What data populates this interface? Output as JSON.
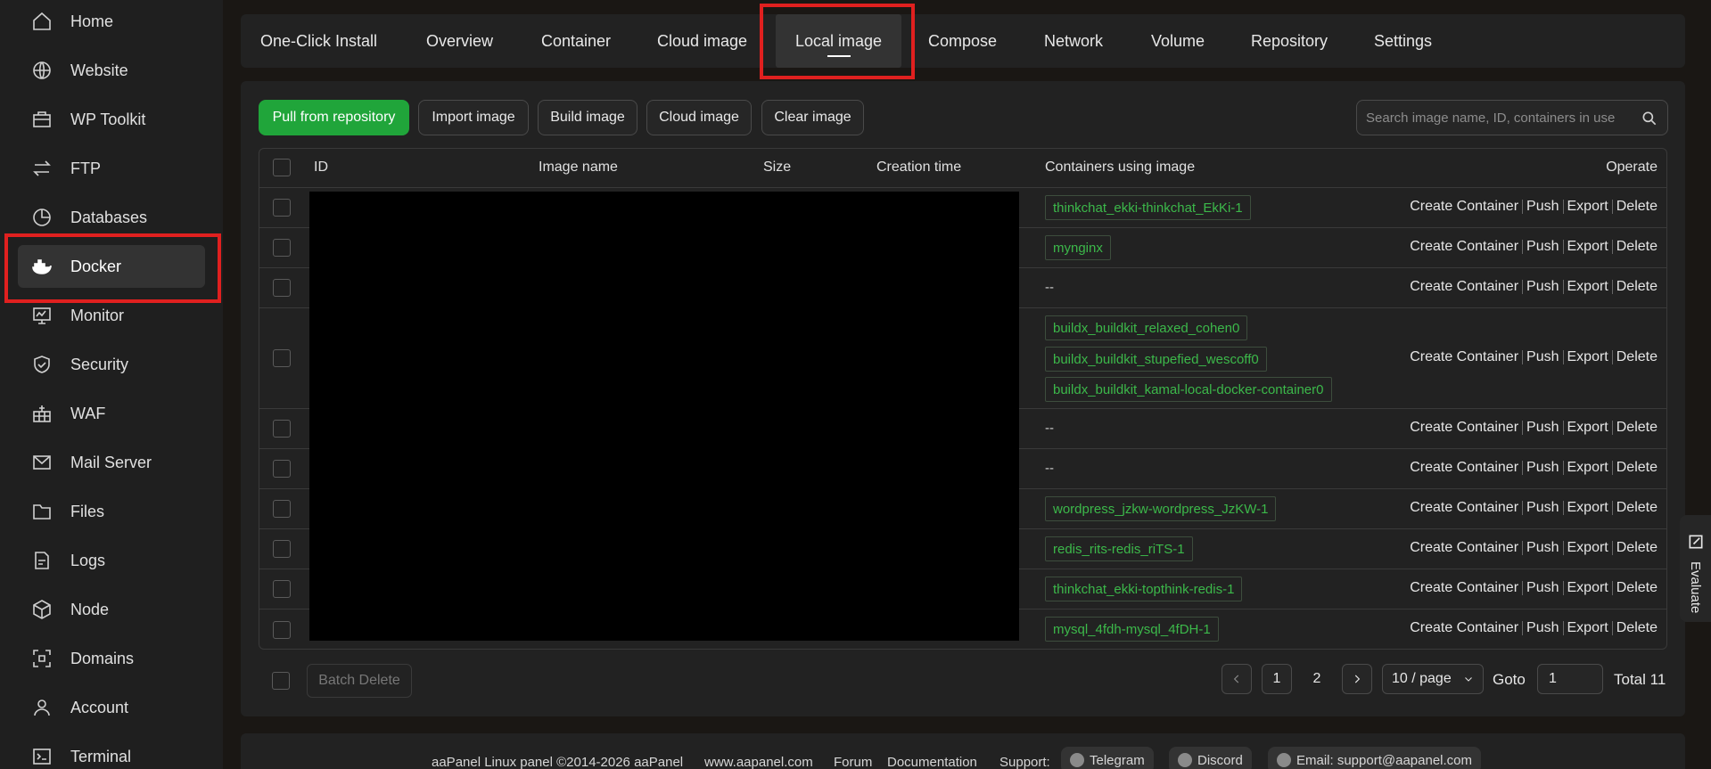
{
  "sidebar": {
    "items": [
      {
        "label": "Home",
        "icon": "home-icon"
      },
      {
        "label": "Website",
        "icon": "globe-icon"
      },
      {
        "label": "WP Toolkit",
        "icon": "toolkit-icon"
      },
      {
        "label": "FTP",
        "icon": "transfer-icon"
      },
      {
        "label": "Databases",
        "icon": "database-icon"
      },
      {
        "label": "Docker",
        "icon": "docker-icon",
        "active": true
      },
      {
        "label": "Monitor",
        "icon": "monitor-icon"
      },
      {
        "label": "Security",
        "icon": "shield-icon"
      },
      {
        "label": "WAF",
        "icon": "firewall-icon"
      },
      {
        "label": "Mail Server",
        "icon": "mail-icon"
      },
      {
        "label": "Files",
        "icon": "folder-icon"
      },
      {
        "label": "Logs",
        "icon": "log-icon"
      },
      {
        "label": "Node",
        "icon": "node-icon"
      },
      {
        "label": "Domains",
        "icon": "domains-icon"
      },
      {
        "label": "Account",
        "icon": "user-icon"
      },
      {
        "label": "Terminal",
        "icon": "terminal-icon"
      }
    ]
  },
  "tabs": [
    {
      "label": "One-Click Install"
    },
    {
      "label": "Overview"
    },
    {
      "label": "Container"
    },
    {
      "label": "Cloud image"
    },
    {
      "label": "Local image",
      "active": true
    },
    {
      "label": "Compose"
    },
    {
      "label": "Network"
    },
    {
      "label": "Volume"
    },
    {
      "label": "Repository"
    },
    {
      "label": "Settings"
    }
  ],
  "toolbar": {
    "pull": "Pull from repository",
    "import": "Import image",
    "build": "Build image",
    "cloud": "Cloud image",
    "clear": "Clear image",
    "search_placeholder": "Search image name, ID, containers in use"
  },
  "table": {
    "headers": {
      "id": "ID",
      "name": "Image name",
      "size": "Size",
      "created": "Creation time",
      "containers": "Containers using image",
      "operate": "Operate"
    },
    "rows": [
      {
        "containers": [
          "thinkchat_ekki-thinkchat_EkKi-1"
        ]
      },
      {
        "containers": [
          "mynginx"
        ]
      },
      {
        "containers": []
      },
      {
        "containers": [
          "buildx_buildkit_relaxed_cohen0",
          "buildx_buildkit_stupefied_wescoff0",
          "buildx_buildkit_kamal-local-docker-container0"
        ]
      },
      {
        "containers": []
      },
      {
        "containers": []
      },
      {
        "containers": [
          "wordpress_jzkw-wordpress_JzKW-1"
        ]
      },
      {
        "containers": [
          "redis_rits-redis_riTS-1"
        ]
      },
      {
        "containers": [
          "thinkchat_ekki-topthink-redis-1"
        ]
      },
      {
        "containers": [
          "mysql_4fdh-mysql_4fDH-1"
        ]
      }
    ],
    "empty_placeholder": "--",
    "ops": {
      "create": "Create Container",
      "push": "Push",
      "export": "Export",
      "delete": "Delete"
    }
  },
  "pager": {
    "batch_delete": "Batch Delete",
    "pages": [
      "1",
      "2"
    ],
    "per_page": "10 / page",
    "goto_label": "Goto",
    "goto_value": "1",
    "total": "Total 11"
  },
  "footer": {
    "copyright": "aaPanel Linux panel ©2014-2026 aaPanel",
    "site": "www.aapanel.com",
    "forum": "Forum",
    "docs": "Documentation",
    "support": "Support:",
    "telegram": "Telegram",
    "discord": "Discord",
    "email": "Email: support@aapanel.com"
  },
  "evaluate": "Evaluate",
  "colors": {
    "accent": "#20a53a",
    "highlight": "#e0201f",
    "tag_text": "#3cb84a"
  }
}
